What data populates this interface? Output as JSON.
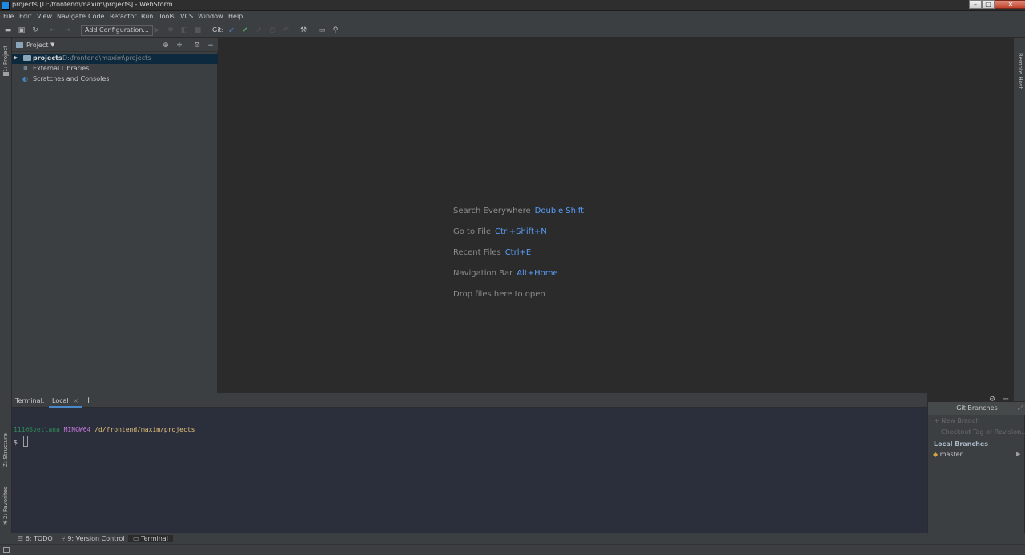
{
  "window": {
    "title": "projects [D:\\frontend\\maxim\\projects] - WebStorm",
    "controls": {
      "minimize": "–",
      "maximize": "□",
      "close": "✕"
    }
  },
  "menu": [
    "File",
    "Edit",
    "View",
    "Navigate",
    "Code",
    "Refactor",
    "Run",
    "Tools",
    "VCS",
    "Window",
    "Help"
  ],
  "toolbar": {
    "add_configuration": "Add Configuration...",
    "git_label": "Git:"
  },
  "project_panel": {
    "title": "Project",
    "items": [
      {
        "label": "projects",
        "path": "D:\\frontend\\maxim\\projects"
      },
      {
        "label": "External Libraries"
      },
      {
        "label": "Scratches and Consoles"
      }
    ]
  },
  "editor_hints": [
    {
      "label": "Search Everywhere",
      "key": "Double Shift"
    },
    {
      "label": "Go to File",
      "key": "Ctrl+Shift+N"
    },
    {
      "label": "Recent Files",
      "key": "Ctrl+E"
    },
    {
      "label": "Navigation Bar",
      "key": "Alt+Home"
    },
    {
      "label": "Drop files here to open",
      "key": ""
    }
  ],
  "left_stripe": {
    "project": "1: Project",
    "structure": "Z: Structure",
    "favorites": "2: Favorites"
  },
  "right_stripe": {
    "remote_host": "Remote Host"
  },
  "terminal": {
    "label": "Terminal:",
    "tab": "Local",
    "prompt_user": "111@Svetlana",
    "prompt_host": "MINGW64",
    "prompt_path": "/d/frontend/maxim/projects",
    "prompt_symbol": "$"
  },
  "git_branches": {
    "title": "Git Branches",
    "new_branch": "+ New Branch",
    "checkout": "Checkout Tag or Revision...",
    "local_header": "Local Branches",
    "branches": [
      "master"
    ]
  },
  "bottom_tabs": [
    {
      "label": "6: TODO"
    },
    {
      "label": "9: Version Control"
    },
    {
      "label": "Terminal"
    }
  ],
  "colors": {
    "accent_blue": "#589df6",
    "terminal_user": "#2e8b57",
    "terminal_host": "#c678dd",
    "terminal_path": "#e5c07b"
  }
}
